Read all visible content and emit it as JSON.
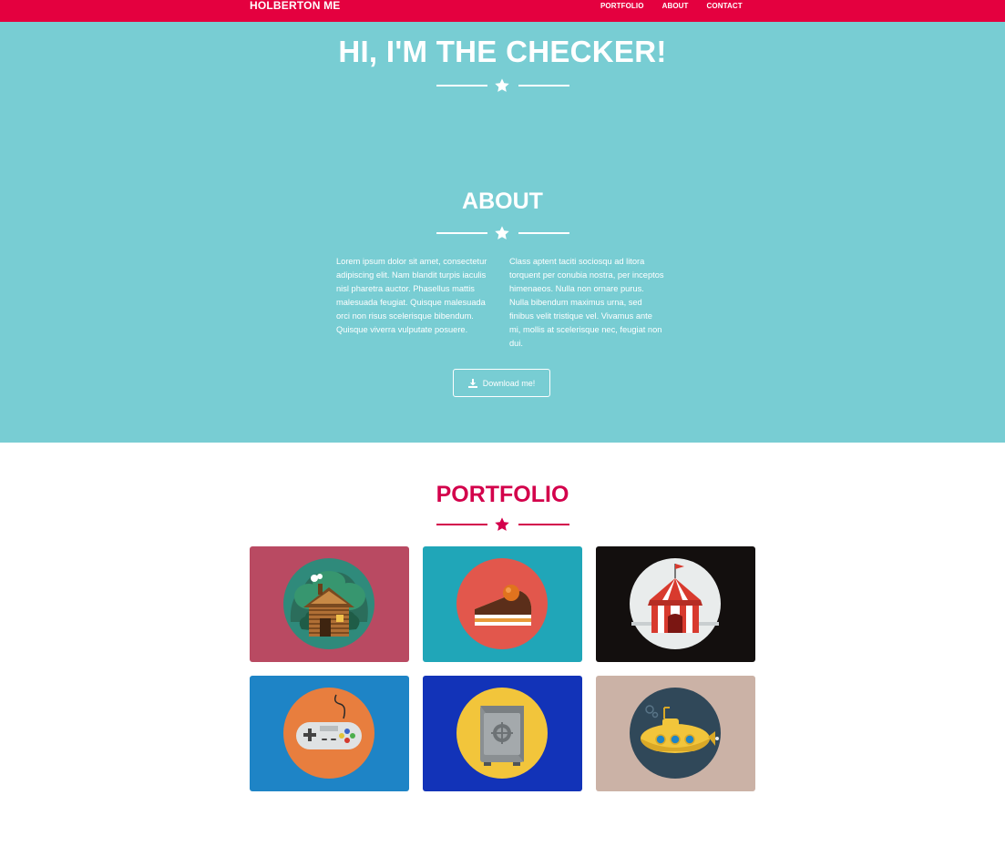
{
  "navbar": {
    "brand": "HOLBERTON ME",
    "links": [
      "PORTFOLIO",
      "ABOUT",
      "CONTACT"
    ],
    "color": "#e4003f"
  },
  "hero": {
    "title": "HI, I'M THE CHECKER!",
    "background": "#78cdd3"
  },
  "about": {
    "title": "ABOUT",
    "paragraph_left": "Lorem ipsum dolor sit amet, consectetur adipiscing elit. Nam blandit turpis iaculis nisl pharetra auctor. Phasellus mattis malesuada feugiat. Quisque malesuada orci non risus scelerisque bibendum. Quisque viverra vulputate posuere.",
    "paragraph_right": "Class aptent taciti sociosqu ad litora torquent per conubia nostra, per inceptos himenaeos. Nulla non ornare purus. Nulla bibendum maximus urna, sed finibus velit tristique vel. Vivamus ante mi, mollis at scelerisque nec, feugiat non dui.",
    "download_label": "Download me!",
    "download_icon": "download-icon"
  },
  "portfolio": {
    "title": "PORTFOLIO",
    "accent": "#d3004b",
    "items": [
      {
        "name": "cabin",
        "icon": "cabin-icon",
        "background": "#b94a62",
        "circle": "#2f8a7b"
      },
      {
        "name": "cake",
        "icon": "cake-icon",
        "background": "#20a6b8",
        "circle": "#e2574c"
      },
      {
        "name": "circus",
        "icon": "circus-tent-icon",
        "background": "#130f0e",
        "circle": "#e9ecec"
      },
      {
        "name": "game",
        "icon": "game-controller-icon",
        "background": "#1e84c6",
        "circle": "#e87e3e"
      },
      {
        "name": "safe",
        "icon": "safe-icon",
        "background": "#1233b8",
        "circle": "#f2c53b"
      },
      {
        "name": "submarine",
        "icon": "submarine-icon",
        "background": "#cbb2a6",
        "circle": "#304859"
      }
    ]
  }
}
